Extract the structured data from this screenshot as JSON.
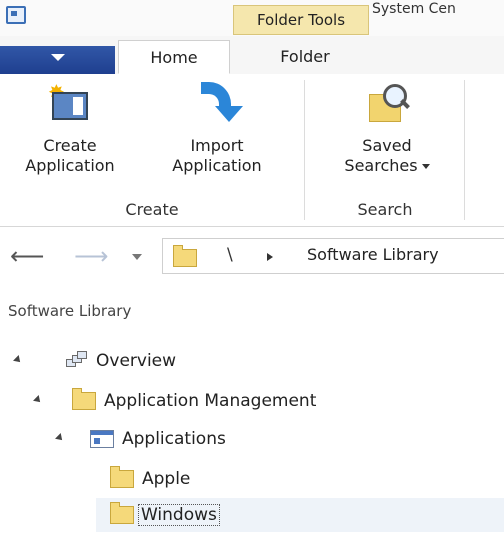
{
  "title_bar": {
    "context_tab": "Folder Tools",
    "window_title": "System Cen"
  },
  "ribbon_tabs": [
    {
      "label": "Home",
      "active": true
    },
    {
      "label": "Folder",
      "active": false
    }
  ],
  "ribbon": {
    "create_group": {
      "label": "Create",
      "buttons": [
        {
          "line1": "Create",
          "line2": "Application"
        },
        {
          "line1": "Import",
          "line2": "Application"
        }
      ]
    },
    "search_group": {
      "label": "Search",
      "saved_searches": {
        "line1": "Saved",
        "line2": "Searches"
      }
    }
  },
  "address_bar": {
    "root": "\\",
    "crumb": "Software Library"
  },
  "navigation_pane": {
    "title": "Software Library",
    "tree": [
      {
        "label": "Overview",
        "icon": "overview-icon"
      },
      {
        "label": "Application Management",
        "icon": "folder-icon"
      },
      {
        "label": "Applications",
        "icon": "applications-icon"
      },
      {
        "label": "Apple",
        "icon": "folder-icon"
      },
      {
        "label": "Windows",
        "icon": "folder-icon",
        "selected": true
      }
    ]
  },
  "colors": {
    "file_button": "#2a4c9c",
    "context_tab": "#f5e7ad",
    "folder": "#f5d97a",
    "selection": "#eef3f9"
  }
}
